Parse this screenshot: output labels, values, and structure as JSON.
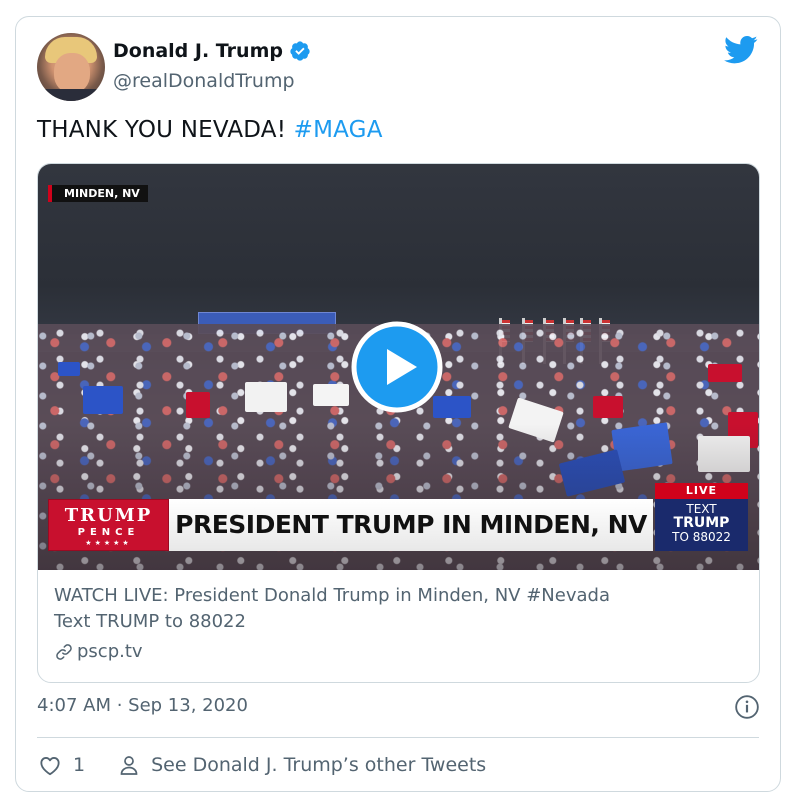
{
  "author": {
    "display_name": "Donald J. Trump",
    "handle": "@realDonaldTrump",
    "verified": true
  },
  "tweet": {
    "text": "THANK YOU NEVADA!",
    "hashtag": "#MAGA"
  },
  "card": {
    "video": {
      "location_tag": "MINDEN, NV",
      "lower_third": {
        "logo_line1": "TRUMP",
        "logo_line2": "PENCE",
        "logo_stars": "★★★★★",
        "headline": "PRESIDENT TRUMP IN MINDEN, NV",
        "live_label": "LIVE",
        "cta_line1": "TEXT",
        "cta_line2": "TRUMP",
        "cta_line3": "TO 88022"
      }
    },
    "title_line1": "WATCH LIVE: President Donald Trump in Minden, NV #Nevada",
    "title_line2": "Text TRUMP to 88022",
    "domain": "pscp.tv"
  },
  "meta": {
    "timestamp": "4:07 AM · Sep 13, 2020"
  },
  "actions": {
    "like_count": "1",
    "see_more": "See Donald J. Trump’s other Tweets"
  },
  "colors": {
    "accent": "#1d9bf0",
    "secondary_text": "#536471",
    "border": "#cfd9de",
    "live_red": "#d0021b",
    "logo_red": "#c8102e",
    "cta_navy": "#1a2a6c"
  },
  "icons": [
    "verified-badge-icon",
    "twitter-bird-icon",
    "play-icon",
    "link-icon",
    "info-icon",
    "heart-icon",
    "person-icon"
  ]
}
